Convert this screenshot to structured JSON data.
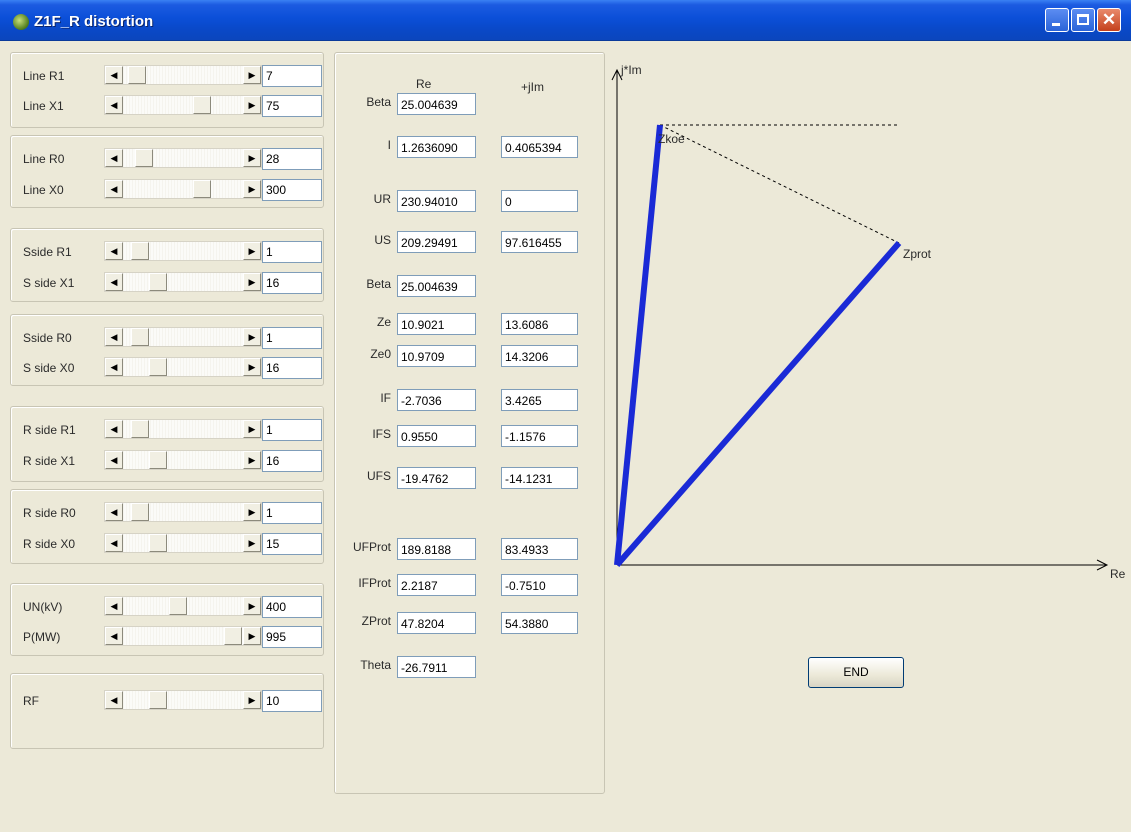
{
  "window": {
    "title": "Z1F_R distortion",
    "buttons": [
      "minimize",
      "maximize",
      "close"
    ],
    "icon": "app-leaf-icon"
  },
  "sliders": [
    {
      "label": "Line R1",
      "value": "7",
      "level_pct": 5
    },
    {
      "label": "Line X1",
      "value": "75",
      "level_pct": 67
    },
    {
      "label": "Line R0",
      "value": "28",
      "level_pct": 12
    },
    {
      "label": "Line X0",
      "value": "300",
      "level_pct": 67
    },
    {
      "label": "Sside R1",
      "value": "1",
      "level_pct": 8
    },
    {
      "label": "S side X1",
      "value": "16",
      "level_pct": 25
    },
    {
      "label": "Sside R0",
      "value": "1",
      "level_pct": 8
    },
    {
      "label": "S side X0",
      "value": "16",
      "level_pct": 25
    },
    {
      "label": "R side R1",
      "value": "1",
      "level_pct": 8
    },
    {
      "label": "R side X1",
      "value": "16",
      "level_pct": 25
    },
    {
      "label": "R side R0",
      "value": "1",
      "level_pct": 8
    },
    {
      "label": "R side X0",
      "value": "15",
      "level_pct": 25
    },
    {
      "label": "UN(kV)",
      "value": "400",
      "level_pct": 44
    },
    {
      "label": "P(MW)",
      "value": "995",
      "level_pct": 97
    },
    {
      "label": "RF",
      "value": "10",
      "level_pct": 25
    }
  ],
  "results": {
    "header_re": "Re",
    "header_im": "+jIm",
    "rows": [
      {
        "label": "Beta",
        "re": "25.004639",
        "im": null
      },
      {
        "label": "I",
        "re": "1.2636090",
        "im": "0.4065394"
      },
      {
        "label": "UR",
        "re": "230.94010",
        "im": "0"
      },
      {
        "label": "US",
        "re": "209.29491",
        "im": "97.616455"
      },
      {
        "label": "Beta",
        "re": "25.004639",
        "im": null
      },
      {
        "label": "Ze",
        "re": "10.9021",
        "im": "13.6086"
      },
      {
        "label": "Ze0",
        "re": "10.9709",
        "im": "14.3206"
      },
      {
        "label": "IF",
        "re": "-2.7036",
        "im": "3.4265"
      },
      {
        "label": "IFS",
        "re": "0.9550",
        "im": "-1.1576"
      },
      {
        "label": "UFS",
        "re": "-19.4762",
        "im": "-14.1231"
      },
      {
        "label": "UFProt",
        "re": "189.8188",
        "im": "83.4933"
      },
      {
        "label": "IFProt",
        "re": "2.2187",
        "im": "-0.7510"
      },
      {
        "label": "ZProt",
        "re": "47.8204",
        "im": "54.3880"
      },
      {
        "label": "Theta",
        "re": "-26.7911",
        "im": null
      }
    ]
  },
  "plot": {
    "y_axis_label": "j*Im",
    "x_axis_label": "Re",
    "zkoe_label": "Zkoe",
    "zprot_label": "Zprot",
    "line_color": "#1a2ad6"
  },
  "end_button": "END"
}
